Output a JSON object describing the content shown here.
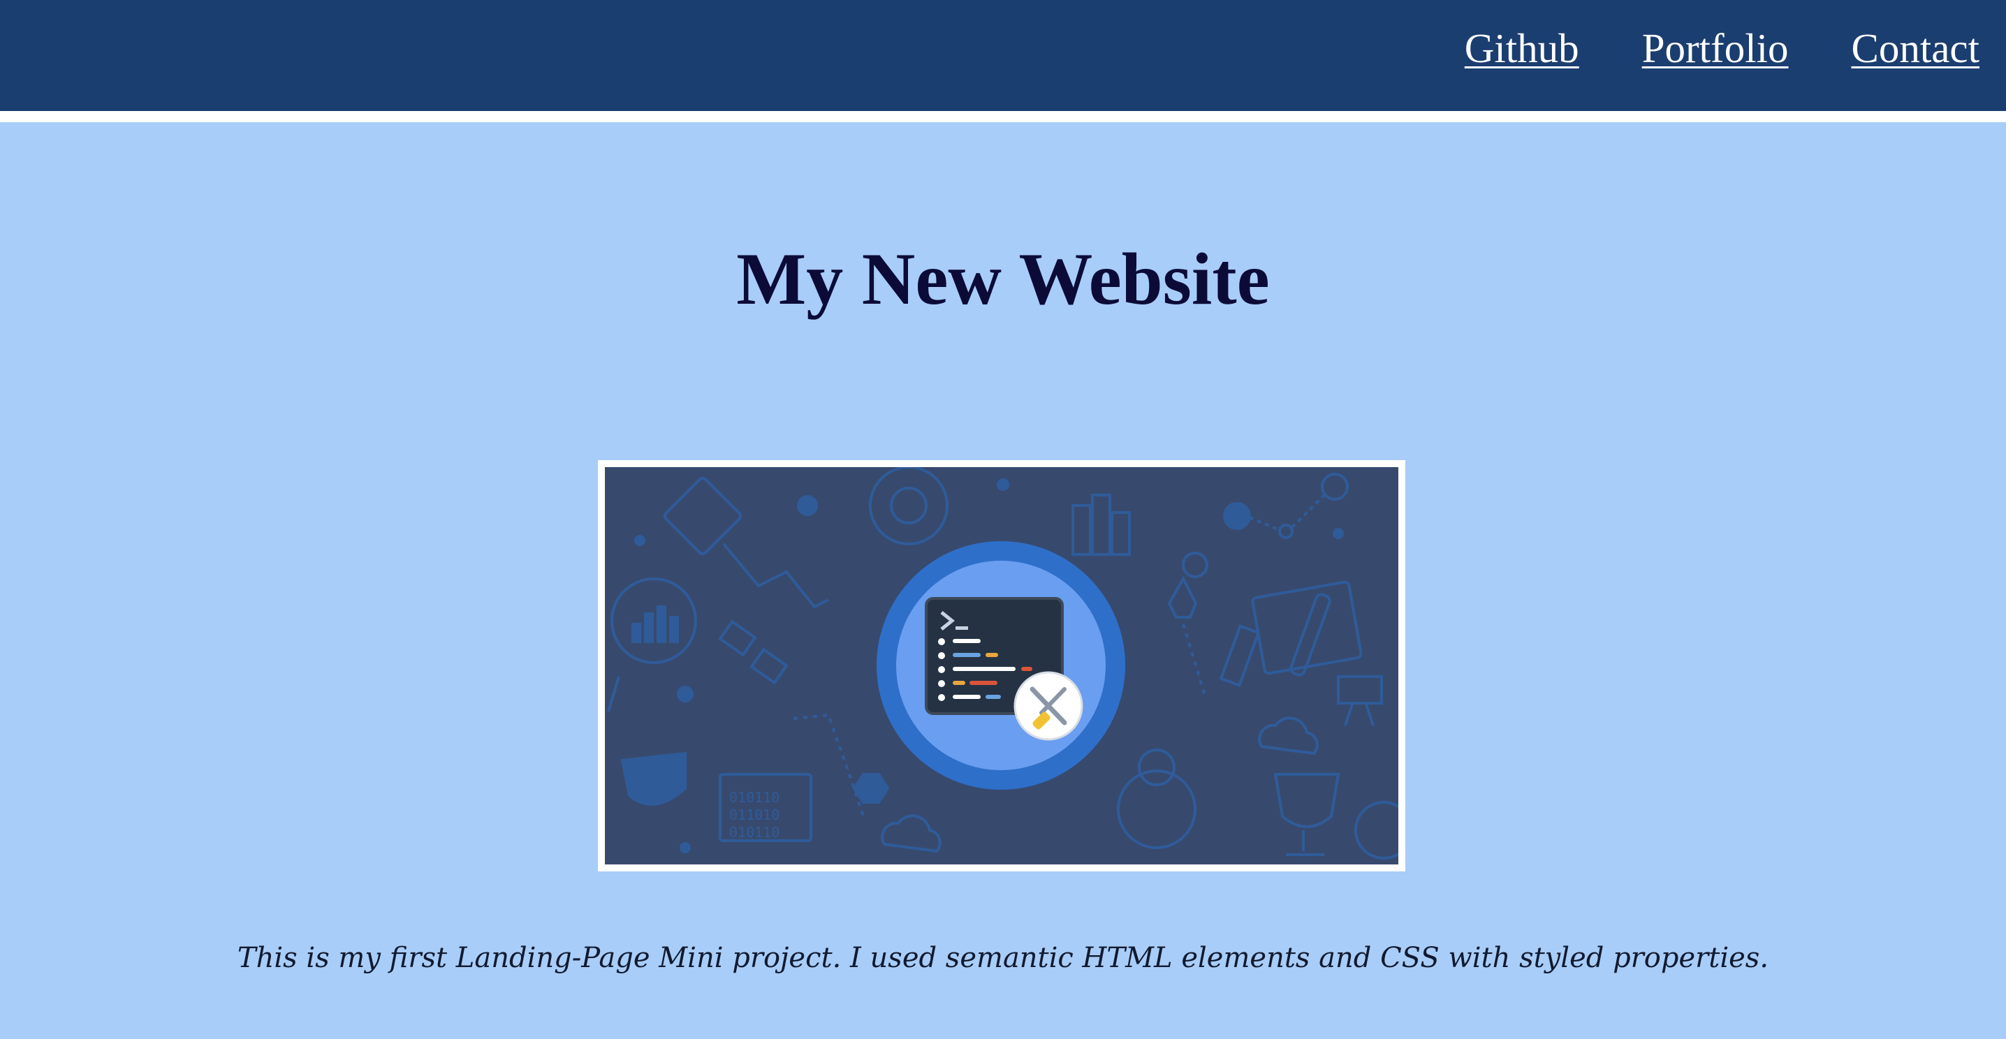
{
  "nav": {
    "links": [
      {
        "label": "Github"
      },
      {
        "label": "Portfolio"
      },
      {
        "label": "Contact"
      }
    ]
  },
  "main": {
    "title": "My New Website",
    "description": "This is my first Landing-Page Mini project. I used semantic HTML elements and CSS with styled properties."
  },
  "colors": {
    "header_bg": "#1b3e70",
    "page_bg": "#a8cdf8",
    "title_color": "#0c0b38",
    "hero_bg": "#374a6e",
    "hero_accent": "#2e6fc9"
  },
  "hero": {
    "icon": "terminal-tools-icon"
  }
}
